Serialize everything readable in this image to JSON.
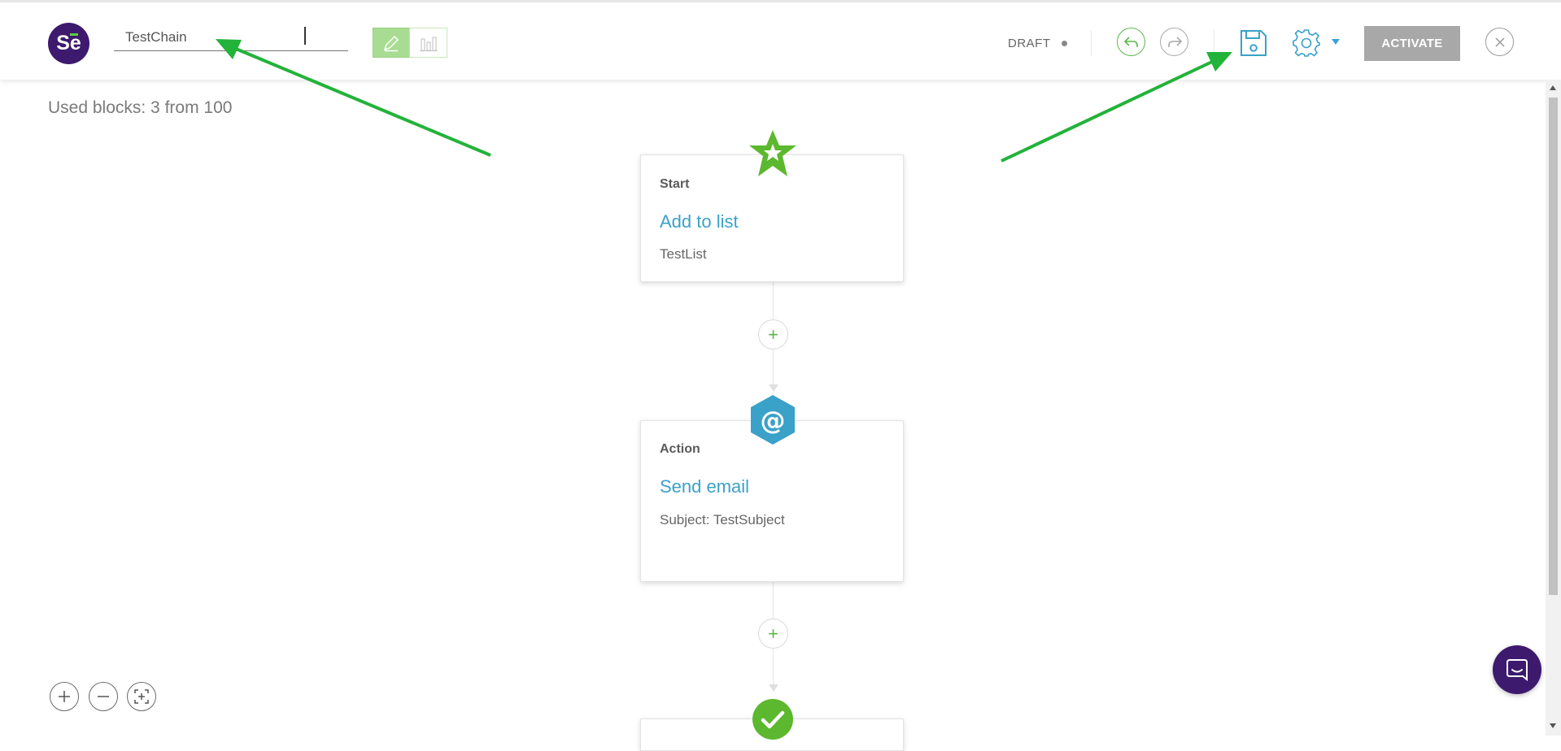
{
  "header": {
    "logo_text": "Se",
    "chain_name": "TestChain",
    "status": "DRAFT",
    "activate_label": "ACTIVATE"
  },
  "canvas": {
    "used_blocks": "Used blocks: 3 from 100",
    "blocks": [
      {
        "type": "Start",
        "title": "Add to list",
        "detail": "TestList",
        "icon": "star-icon"
      },
      {
        "type": "Action",
        "title": "Send email",
        "detail": "Subject: TestSubject",
        "icon": "at-sign-icon"
      },
      {
        "icon": "checkmark-icon"
      }
    ]
  },
  "colors": {
    "brand": "#3d1a6e",
    "accent_green": "#5ed13b",
    "accent_blue": "#3aa1c8",
    "annotation_arrow": "#22b33a",
    "activate_disabled": "#a8a8a8"
  }
}
